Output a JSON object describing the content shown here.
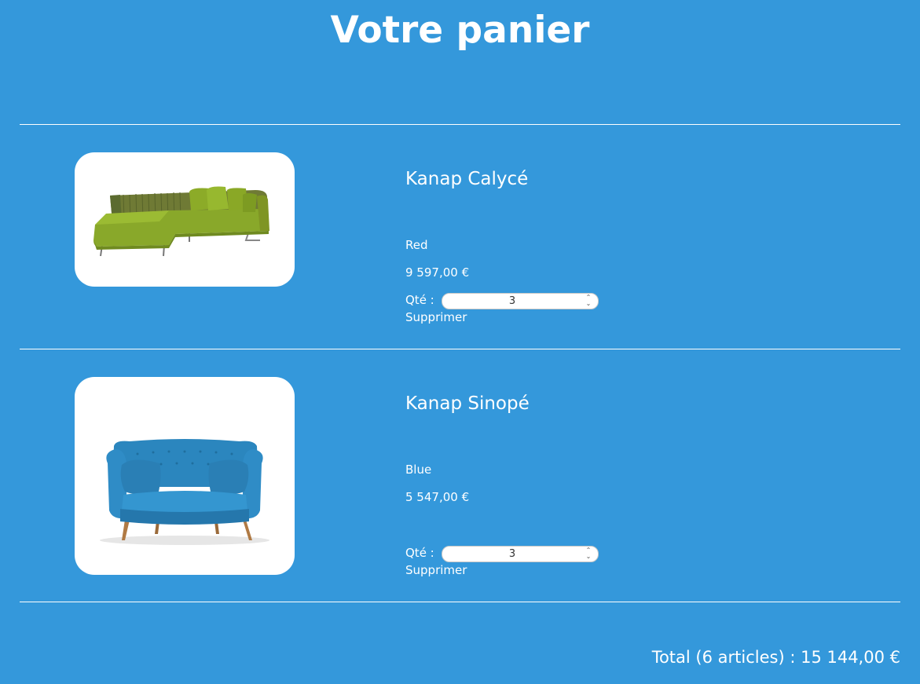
{
  "page": {
    "title": "Votre panier"
  },
  "cart": {
    "qty_label": "Qté :",
    "delete_label": "Supprimer",
    "items": [
      {
        "name": "Kanap Calycé",
        "color": "Red",
        "price": "9 597,00 €",
        "quantity": "3",
        "image_alt": "green-corner-sofa-image"
      },
      {
        "name": "Kanap Sinopé",
        "color": "Blue",
        "price": "5 547,00 €",
        "quantity": "3",
        "image_alt": "blue-sofa-image"
      }
    ]
  },
  "total": {
    "text": "Total (6 articles) : 15 144,00 €"
  },
  "colors": {
    "background": "#3498db",
    "text": "#ffffff",
    "card": "#ffffff"
  }
}
